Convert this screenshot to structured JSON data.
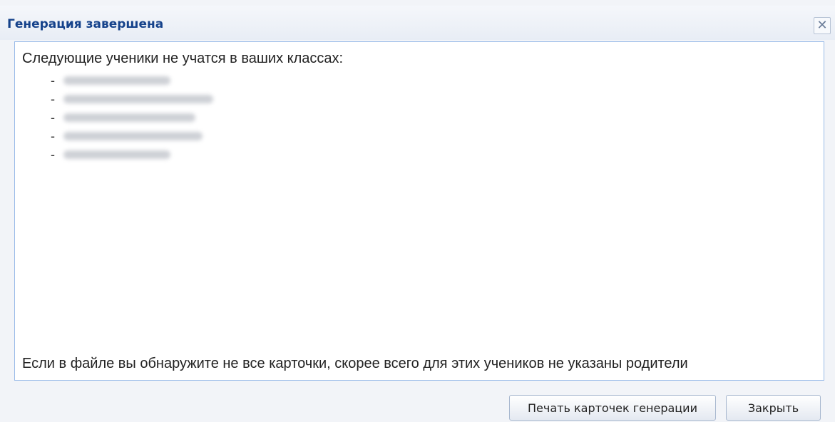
{
  "dialog": {
    "title": "Генерация завершена",
    "close_glyph": "✕"
  },
  "content": {
    "intro": "Следующие ученики не учатся в ваших классах:",
    "students": [
      {
        "dash": "-"
      },
      {
        "dash": "-"
      },
      {
        "dash": "-"
      },
      {
        "dash": "-"
      },
      {
        "dash": "-"
      }
    ],
    "note": " Если в файле вы обнаружите не все карточки, скорее всего для этих учеников не указаны родители"
  },
  "buttons": {
    "print_label": "Печать карточек генерации",
    "close_label": "Закрыть"
  },
  "colors": {
    "title": "#15428b",
    "border": "#99bbe8",
    "background": "#f2f4f8"
  },
  "icons": {
    "close": "close-icon"
  }
}
